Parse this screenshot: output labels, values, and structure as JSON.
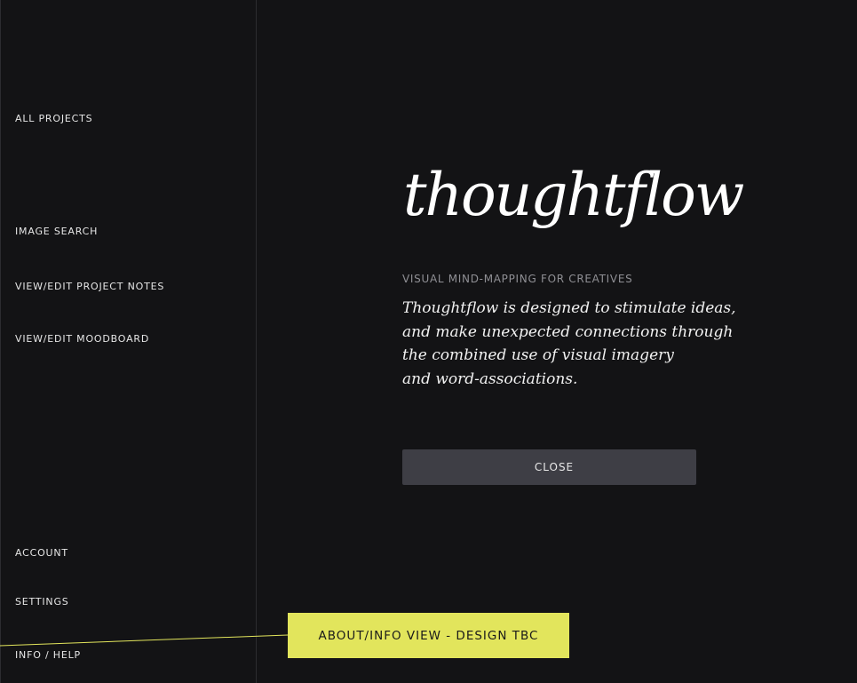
{
  "sidebar": {
    "items": [
      {
        "label": "ALL PROJECTS"
      },
      {
        "label": "IMAGE SEARCH"
      },
      {
        "label": "VIEW/EDIT PROJECT NOTES"
      },
      {
        "label": "VIEW/EDIT MOODBOARD"
      },
      {
        "label": "ACCOUNT"
      },
      {
        "label": "SETTINGS"
      },
      {
        "label": "INFO / HELP"
      }
    ]
  },
  "about": {
    "logo": "thoughtflow",
    "tagline": "VISUAL MIND-MAPPING FOR CREATIVES",
    "description_lines": [
      "Thoughtflow is designed to stimulate ideas,",
      "and make unexpected connections through",
      "the combined use of visual imagery",
      "and word-associations."
    ],
    "close_label": "CLOSE"
  },
  "annotation": {
    "label": "ABOUT/INFO VIEW - DESIGN TBC"
  },
  "colors": {
    "background": "#131315",
    "button": "#3e3e45",
    "annotation_accent": "#e2e55c",
    "tagline": "#8f8f94"
  }
}
